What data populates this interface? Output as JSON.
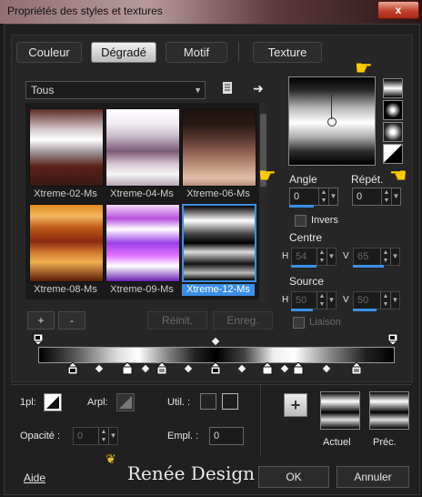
{
  "window": {
    "title": "Propriétés des styles et textures",
    "close_label": "x"
  },
  "tabs": [
    {
      "label": "Couleur",
      "active": false
    },
    {
      "label": "Dégradé",
      "active": true
    },
    {
      "label": "Motif",
      "active": false
    },
    {
      "label": "Texture",
      "active": false
    }
  ],
  "category": {
    "selected": "Tous"
  },
  "gradients": [
    {
      "label": "Xtreme-02-Ms",
      "colors": [
        "#5b2b25",
        "#d0c0c3",
        "#fff",
        "#a49ba0",
        "#5a2018",
        "#3a1a16"
      ]
    },
    {
      "label": "Xtreme-04-Ms",
      "colors": [
        "#ffffff",
        "#c9bcc9",
        "#7a5a76",
        "#d8c8d6",
        "#f5f5f5",
        "#b8a8b6"
      ]
    },
    {
      "label": "Xtreme-06-Ms",
      "colors": [
        "#2a1a16",
        "#5a3a30",
        "#9a6a58",
        "#c7a08a",
        "#e0c0aa",
        "#b89080"
      ]
    },
    {
      "label": "Xtreme-08-Ms",
      "colors": [
        "#e08a20",
        "#f4b860",
        "#c05a18",
        "#8a2a10",
        "#d07830",
        "#5a1a08"
      ]
    },
    {
      "label": "Xtreme-09-Ms",
      "colors": [
        "#f4d8f8",
        "#b850e0",
        "#ffffff",
        "#9a40e8",
        "#e070ff",
        "#6a20b0"
      ]
    },
    {
      "label": "Xtreme-12-Ms",
      "colors": [
        "#000000",
        "#ffffff",
        "#444444",
        "#dddddd",
        "#111111",
        "#bbbbbb"
      ],
      "selected": true
    }
  ],
  "grid_buttons": {
    "add": "+",
    "remove": "-",
    "reset": "Réinit.",
    "save": "Enreg."
  },
  "angle": {
    "label": "Angle",
    "value": "0"
  },
  "repeat": {
    "label": "Répét.",
    "value": "0"
  },
  "invert": {
    "label": "Invers",
    "checked": false
  },
  "center": {
    "label": "Centre",
    "h_label": "H",
    "h_value": "54",
    "v_label": "V",
    "v_value": "65"
  },
  "source": {
    "label": "Source",
    "h_label": "H",
    "h_value": "50",
    "v_label": "V",
    "v_value": "50"
  },
  "link": {
    "label": "Liaison",
    "checked": false
  },
  "stops": {
    "opacity_label": "Opacité :",
    "opacity_value": "0",
    "location_label": "Empl. :",
    "location_value": "0",
    "stop_label": "1pl:",
    "arpl_label": "Arpl:",
    "util_label": "Util. :"
  },
  "swatches": {
    "add_label": "+",
    "current_label": "Actuel",
    "previous_label": "Préc."
  },
  "footer": {
    "help": "Aide",
    "ok": "OK",
    "cancel": "Annuler",
    "logo_text": "Renée Design"
  },
  "accent_color": "#3c8fe6"
}
